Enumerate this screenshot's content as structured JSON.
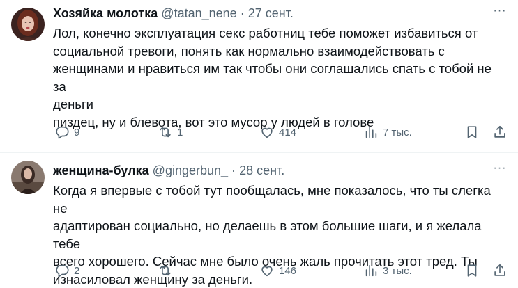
{
  "tweets": [
    {
      "author_name": "Хозяйка молотка",
      "handle": "@tatan_nene",
      "separator": "·",
      "date": "27 сент.",
      "more_label": "···",
      "text_lines": [
        "Лол, конечно эксплуатация секс работниц тебе поможет избавиться от",
        "социальной тревоги, понять как нормально взаимодействовать с",
        "женщинами и нравиться им так чтобы они соглашались спать с тобой не за",
        "деньги",
        "пиздец, ну и блевота, вот это мусор у людей в голове"
      ],
      "replies": "9",
      "retweets": "1",
      "likes": "414",
      "views": "7 тыс."
    },
    {
      "author_name": "женщина-булка",
      "handle": "@gingerbun_",
      "separator": "·",
      "date": "28 сент.",
      "more_label": "···",
      "text_lines": [
        "Когда я впервые с тобой тут пообщалась, мне показалось, что ты слегка не",
        "адаптирован социально, но делаешь в этом большие шаги, и я желала тебе",
        "всего хорошего. Сейчас мне было очень жаль прочитать этот тред. Ты",
        "изнасиловал женщину за деньги."
      ],
      "replies": "2",
      "retweets": "",
      "likes": "146",
      "views": "3 тыс."
    }
  ],
  "colors": {
    "text": "#0f1419",
    "secondary": "#536471",
    "divider": "#eff3f4"
  },
  "icons": [
    "reply-icon",
    "retweet-icon",
    "like-icon",
    "views-icon",
    "bookmark-icon",
    "share-icon",
    "more-icon"
  ]
}
